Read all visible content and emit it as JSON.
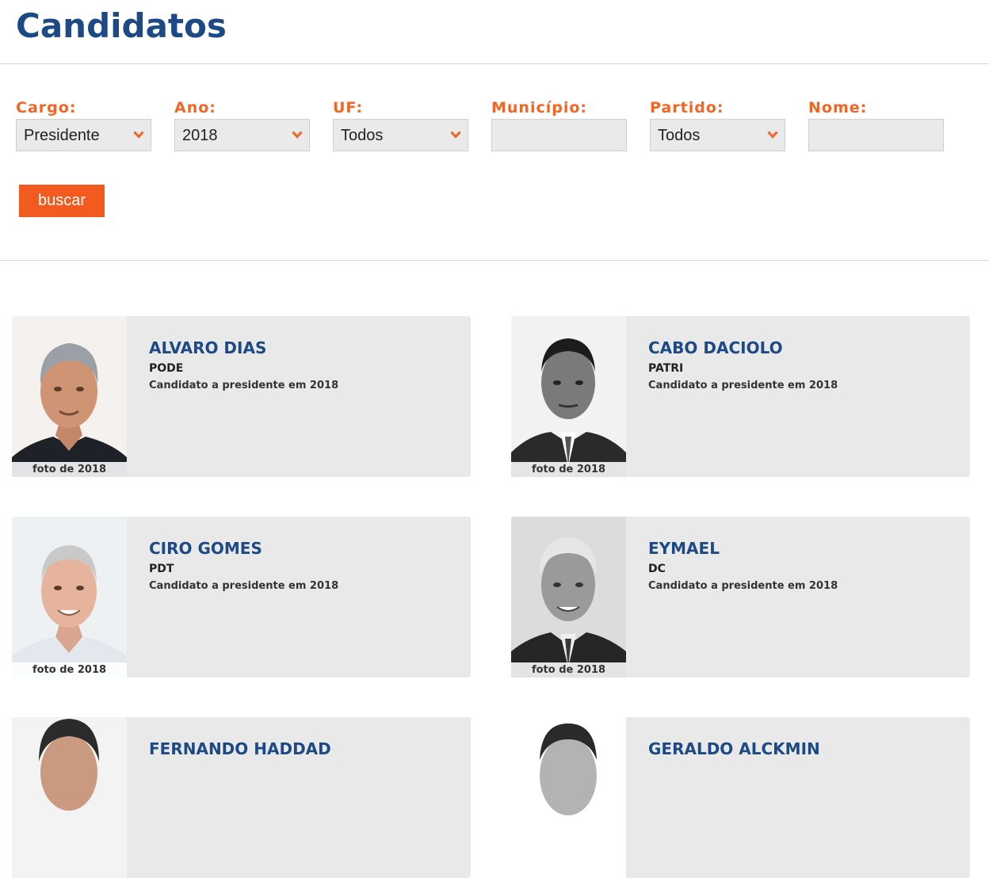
{
  "page": {
    "title": "Candidatos"
  },
  "filters": {
    "cargo": {
      "label": "Cargo:",
      "value": "Presidente"
    },
    "ano": {
      "label": "Ano:",
      "value": "2018"
    },
    "uf": {
      "label": "UF:",
      "value": "Todos"
    },
    "municipio": {
      "label": "Município:",
      "value": ""
    },
    "partido": {
      "label": "Partido:",
      "value": "Todos"
    },
    "nome": {
      "label": "Nome:",
      "value": ""
    },
    "search_label": "buscar"
  },
  "candidates": [
    {
      "name": "ALVARO DIAS",
      "party": "PODE",
      "description": "Candidato a presidente em 2018",
      "photo_caption": "foto de 2018"
    },
    {
      "name": "CABO DACIOLO",
      "party": "PATRI",
      "description": "Candidato a presidente em 2018",
      "photo_caption": "foto de 2018"
    },
    {
      "name": "CIRO GOMES",
      "party": "PDT",
      "description": "Candidato a presidente em 2018",
      "photo_caption": "foto de 2018"
    },
    {
      "name": "EYMAEL",
      "party": "DC",
      "description": "Candidato a presidente em 2018",
      "photo_caption": "foto de 2018"
    },
    {
      "name": "FERNANDO HADDAD",
      "party": "",
      "description": "",
      "photo_caption": ""
    },
    {
      "name": "GERALDO ALCKMIN",
      "party": "",
      "description": "",
      "photo_caption": ""
    }
  ],
  "colors": {
    "brand_blue": "#1d4a85",
    "accent_orange": "#f26522",
    "button_orange": "#f25a1f",
    "card_bg": "#e9e9e9"
  },
  "icons": {
    "select_arrow": "chevron-down-icon"
  }
}
